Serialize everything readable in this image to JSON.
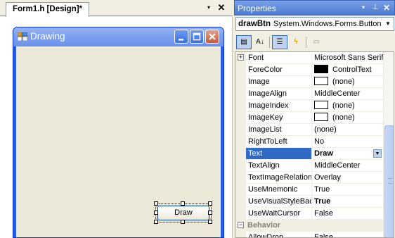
{
  "designer": {
    "tab_title": "Form1.h [Design]*",
    "dropdown_glyph": "▾",
    "close_glyph": "✕",
    "form": {
      "title": "Drawing",
      "minimize_glyph": "_",
      "maximize_glyph": "□",
      "close_glyph": "✕",
      "button_label": "Draw"
    }
  },
  "properties": {
    "title": "Properties",
    "dropdown_glyph": "▾",
    "pin_glyph": "⊥",
    "close_glyph": "✕",
    "selected_object": {
      "name": "drawBtn",
      "type": "System.Windows.Forms.Button",
      "arrow_glyph": "▼"
    },
    "toolbar": {
      "categorized_glyph": "▤",
      "alphabetical_glyph": "A↓",
      "properties_glyph": "☰",
      "events_glyph": "ϟ",
      "pages_glyph": "▭"
    },
    "rows": [
      {
        "name": "Font",
        "value": "Microsoft Sans Serif",
        "expander": "+"
      },
      {
        "name": "ForeColor",
        "value": "ControlText",
        "swatch": "#000000"
      },
      {
        "name": "Image",
        "value": "(none)",
        "swatch": "#ffffff"
      },
      {
        "name": "ImageAlign",
        "value": "MiddleCenter"
      },
      {
        "name": "ImageIndex",
        "value": "(none)",
        "swatch": "#ffffff"
      },
      {
        "name": "ImageKey",
        "value": "(none)",
        "swatch": "#ffffff"
      },
      {
        "name": "ImageList",
        "value": "(none)"
      },
      {
        "name": "RightToLeft",
        "value": "No"
      },
      {
        "name": "Text",
        "value": "Draw",
        "selected": true,
        "bold": true
      },
      {
        "name": "TextAlign",
        "value": "MiddleCenter"
      },
      {
        "name": "TextImageRelation",
        "value": "Overlay"
      },
      {
        "name": "UseMnemonic",
        "value": "True"
      },
      {
        "name": "UseVisualStyleBackColor",
        "value": "True",
        "bold": true
      },
      {
        "name": "UseWaitCursor",
        "value": "False"
      }
    ],
    "category": {
      "name": "Behavior",
      "expander": "−"
    },
    "after_category": [
      {
        "name": "AllowDrop",
        "value": "False"
      }
    ]
  },
  "colors": {
    "selection": "#316ac5",
    "titlebar": "#4a7ad0",
    "form_border": "#0831d9"
  }
}
